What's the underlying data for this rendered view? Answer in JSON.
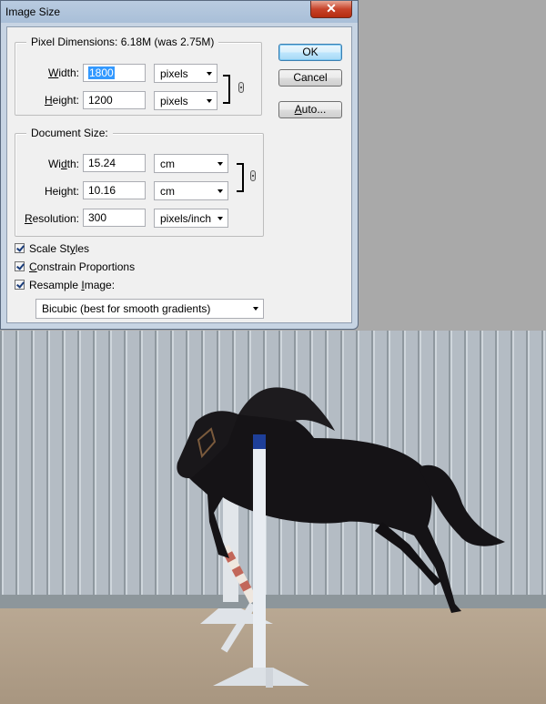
{
  "dialog": {
    "title": "Image Size",
    "close_glyph": "✕",
    "pixel_dimensions": {
      "legend": "Pixel Dimensions:",
      "size_text": "6.18M (was 2.75M)",
      "width_label_pre": "",
      "width_label_u": "W",
      "width_label_post": "idth:",
      "width_value": "1800",
      "width_unit": "pixels",
      "height_label_pre": "",
      "height_label_u": "H",
      "height_label_post": "eight:",
      "height_value": "1200",
      "height_unit": "pixels"
    },
    "document_size": {
      "legend": "Document Size:",
      "width_label_pre": "Wi",
      "width_label_u": "d",
      "width_label_post": "th:",
      "width_value": "15.24",
      "width_unit": "cm",
      "height_label_pre": "Hei",
      "height_label_u": "g",
      "height_label_post": "ht:",
      "height_value": "10.16",
      "height_unit": "cm",
      "resolution_label_pre": "",
      "resolution_label_u": "R",
      "resolution_label_post": "esolution:",
      "resolution_value": "300",
      "resolution_unit": "pixels/inch"
    },
    "buttons": {
      "ok": "OK",
      "cancel": "Cancel",
      "auto_pre": "",
      "auto_u": "A",
      "auto_post": "uto..."
    },
    "options": {
      "scale_styles_pre": "Scale St",
      "scale_styles_u": "y",
      "scale_styles_post": "les",
      "scale_styles_checked": true,
      "constrain_pre": "",
      "constrain_u": "C",
      "constrain_post": "onstrain Proportions",
      "constrain_checked": true,
      "resample_pre": "Resample ",
      "resample_u": "I",
      "resample_post": "mage:",
      "resample_checked": true,
      "resample_method": "Bicubic (best for smooth gradients)"
    }
  },
  "photo": {
    "subject": "black horse jumping over a white pole fence",
    "colors": {
      "wall": "#b3bcc3",
      "ground": "#b7a58f",
      "horse": "#161417",
      "pole": "#e8ecf1",
      "pole_top": "#1e3f99"
    }
  },
  "colors": {
    "background": "#a9a9a9",
    "dialog_frame": "#c7d4e3",
    "client": "#f0f0f0",
    "close_button": "#c7432a",
    "selection": "#3399ff"
  }
}
